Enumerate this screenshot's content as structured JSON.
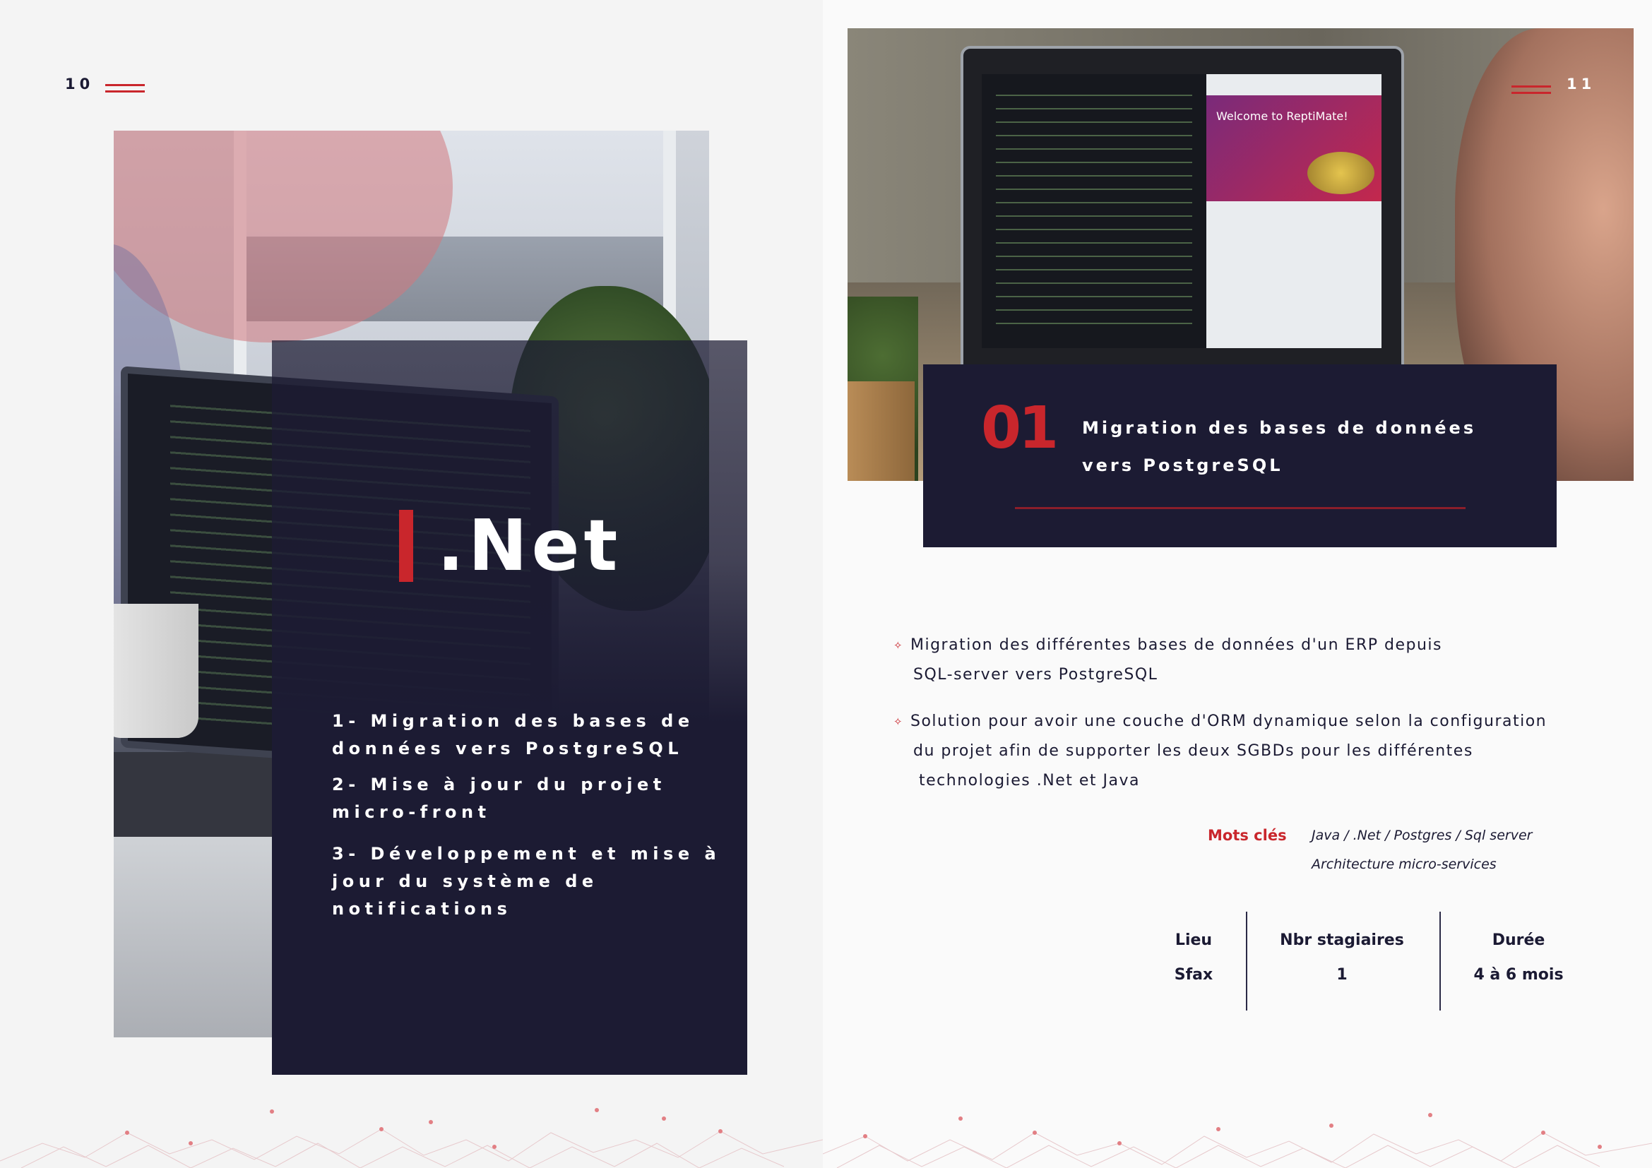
{
  "left_page": {
    "page_number": "10",
    "title": ".Net",
    "items": [
      "1- Migration des bases de données vers PostgreSQL",
      "2- Mise à jour du projet micro-front",
      "3- Développement et mise à jour du système de notifications"
    ]
  },
  "right_page": {
    "page_number": "11",
    "screen_text": "Welcome to ReptiMate!",
    "project_number": "01",
    "project_title_line1": "Migration des bases de données",
    "project_title_line2": "vers PostgreSQL",
    "bullets": [
      {
        "line1": "Migration des différentes bases de données d'un ERP depuis",
        "line2": "SQL-server vers PostgreSQL",
        "line3": ""
      },
      {
        "line1": "Solution pour avoir une couche d'ORM dynamique selon la configuration",
        "line2": "du projet afin de supporter les deux SGBDs pour les différentes",
        "line3": "technologies .Net et Java"
      }
    ],
    "bullet_icon": "sparkle-icon",
    "keywords_label": "Mots clés",
    "keywords_line1": "Java / .Net / Postgres / Sql server",
    "keywords_line2": "Architecture micro-services",
    "info": [
      {
        "label": "Lieu",
        "value": "Sfax"
      },
      {
        "label": "Nbr stagiaires",
        "value": "1"
      },
      {
        "label": "Durée",
        "value": "4 à 6 mois"
      }
    ]
  },
  "colors": {
    "accent": "#c9262c",
    "navy": "#1c1b33"
  }
}
